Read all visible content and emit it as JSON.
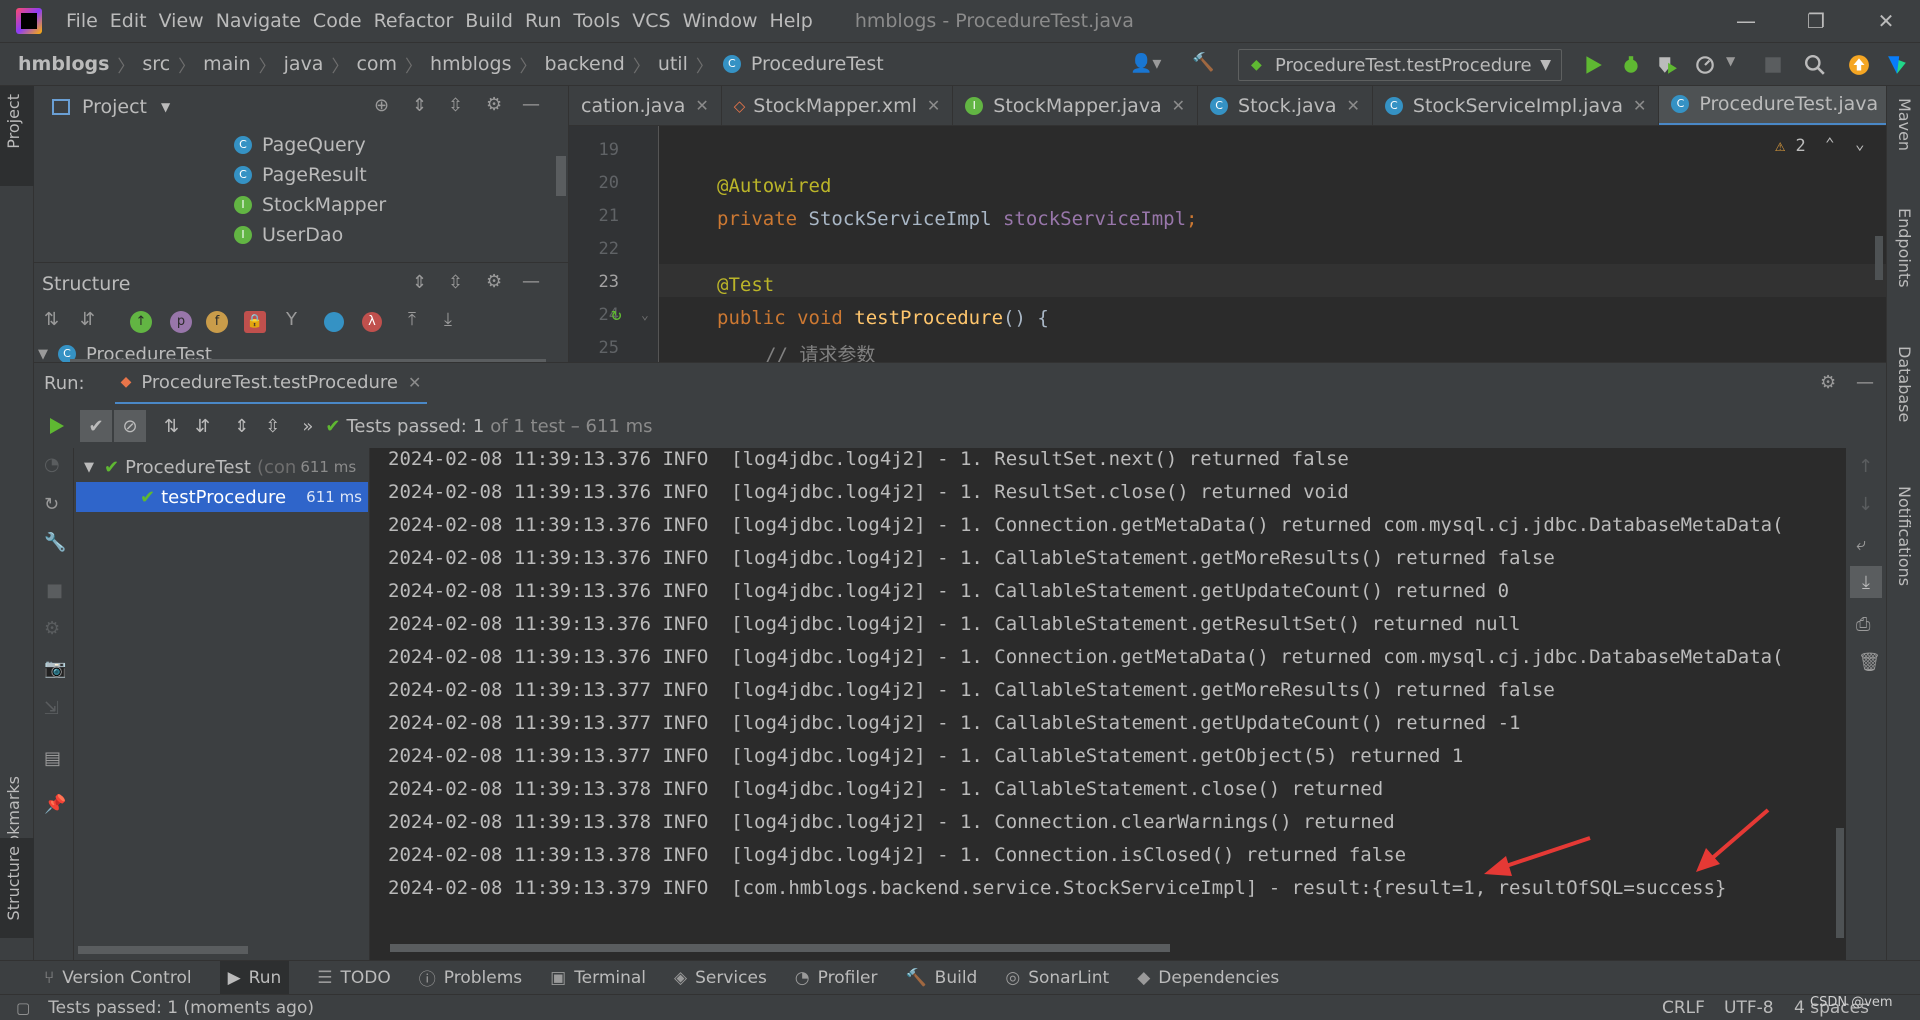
{
  "menu": {
    "items": [
      "File",
      "Edit",
      "View",
      "Navigate",
      "Code",
      "Refactor",
      "Build",
      "Run",
      "Tools",
      "VCS",
      "Window",
      "Help"
    ],
    "window_title": "hmblogs - ProcedureTest.java"
  },
  "breadcrumb": [
    "hmblogs",
    "src",
    "main",
    "java",
    "com",
    "hmblogs",
    "backend",
    "util",
    "ProcedureTest"
  ],
  "run_config": "ProcedureTest.testProcedure",
  "project_panel": {
    "title": "Project",
    "items": [
      {
        "label": "PageQuery",
        "kind": "C"
      },
      {
        "label": "PageResult",
        "kind": "C"
      },
      {
        "label": "StockMapper",
        "kind": "I"
      },
      {
        "label": "UserDao",
        "kind": "I"
      }
    ]
  },
  "structure_panel": {
    "title": "Structure",
    "root": "ProcedureTest"
  },
  "editor": {
    "tabs": [
      {
        "label": "cation.java",
        "active": false
      },
      {
        "label": "StockMapper.xml",
        "active": false
      },
      {
        "label": "StockMapper.java",
        "active": false
      },
      {
        "label": "Stock.java",
        "active": false
      },
      {
        "label": "StockServiceImpl.java",
        "active": false
      },
      {
        "label": "ProcedureTest.java",
        "active": true
      }
    ],
    "warnings": "2",
    "lines": [
      {
        "num": "19",
        "text": ""
      },
      {
        "num": "20",
        "text": "@Autowired"
      },
      {
        "num": "21",
        "text": "private StockServiceImpl stockServiceImpl;"
      },
      {
        "num": "22",
        "text": ""
      },
      {
        "num": "23",
        "text": "@Test"
      },
      {
        "num": "24",
        "text": "public void testProcedure() {"
      },
      {
        "num": "25",
        "text": "// 请求参数"
      }
    ]
  },
  "run_panel": {
    "label": "Run:",
    "tab": "ProcedureTest.testProcedure",
    "tests_passed_label": "Tests passed:",
    "tests_passed_count": "1",
    "tests_passed_detail": "of 1 test – 611 ms",
    "tree": [
      {
        "label": "ProcedureTest",
        "note": "(con",
        "time": "611 ms"
      },
      {
        "label": "testProcedure",
        "time": "611 ms"
      }
    ],
    "log_lines": [
      "2024-02-08 11:39:13.376 INFO  [log4jdbc.log4j2] - 1. ResultSet.next() returned false",
      "2024-02-08 11:39:13.376 INFO  [log4jdbc.log4j2] - 1. ResultSet.close() returned void",
      "2024-02-08 11:39:13.376 INFO  [log4jdbc.log4j2] - 1. Connection.getMetaData() returned com.mysql.cj.jdbc.DatabaseMetaData(",
      "2024-02-08 11:39:13.376 INFO  [log4jdbc.log4j2] - 1. CallableStatement.getMoreResults() returned false",
      "2024-02-08 11:39:13.376 INFO  [log4jdbc.log4j2] - 1. CallableStatement.getUpdateCount() returned 0",
      "2024-02-08 11:39:13.376 INFO  [log4jdbc.log4j2] - 1. CallableStatement.getResultSet() returned null",
      "2024-02-08 11:39:13.376 INFO  [log4jdbc.log4j2] - 1. Connection.getMetaData() returned com.mysql.cj.jdbc.DatabaseMetaData(",
      "2024-02-08 11:39:13.377 INFO  [log4jdbc.log4j2] - 1. CallableStatement.getMoreResults() returned false",
      "2024-02-08 11:39:13.377 INFO  [log4jdbc.log4j2] - 1. CallableStatement.getUpdateCount() returned -1",
      "2024-02-08 11:39:13.377 INFO  [log4jdbc.log4j2] - 1. CallableStatement.getObject(5) returned 1",
      "2024-02-08 11:39:13.378 INFO  [log4jdbc.log4j2] - 1. CallableStatement.close() returned",
      "2024-02-08 11:39:13.378 INFO  [log4jdbc.log4j2] - 1. Connection.clearWarnings() returned",
      "2024-02-08 11:39:13.378 INFO  [log4jdbc.log4j2] - 1. Connection.isClosed() returned false",
      "2024-02-08 11:39:13.379 INFO  [com.hmblogs.backend.service.StockServiceImpl] - result:{result=1, resultOfSQL=success}"
    ]
  },
  "left_stripe": {
    "project": "Project",
    "bookmarks": "Bookmarks",
    "structure": "Structure"
  },
  "right_stripe": {
    "maven": "Maven",
    "endpoints": "Endpoints",
    "database": "Database",
    "notifications": "Notifications"
  },
  "tool_tabs": [
    {
      "label": "Version Control",
      "icon": "vcs-icon"
    },
    {
      "label": "Run",
      "icon": "run-icon"
    },
    {
      "label": "TODO",
      "icon": "todo-icon"
    },
    {
      "label": "Problems",
      "icon": "problems-icon"
    },
    {
      "label": "Terminal",
      "icon": "terminal-icon"
    },
    {
      "label": "Services",
      "icon": "services-icon"
    },
    {
      "label": "Profiler",
      "icon": "profiler-icon"
    },
    {
      "label": "Build",
      "icon": "build-icon"
    },
    {
      "label": "SonarLint",
      "icon": "sonarlint-icon"
    },
    {
      "label": "Dependencies",
      "icon": "dependencies-icon"
    }
  ],
  "status": {
    "message": "Tests passed: 1 (moments ago)",
    "line_sep": "CRLF",
    "encoding": "UTF-8",
    "indent": "4 spaces",
    "watermark": "CSDN @vem"
  },
  "colors": {
    "accent": "#4a88c7",
    "pass": "#5fb832",
    "arrow": "#e53935"
  }
}
